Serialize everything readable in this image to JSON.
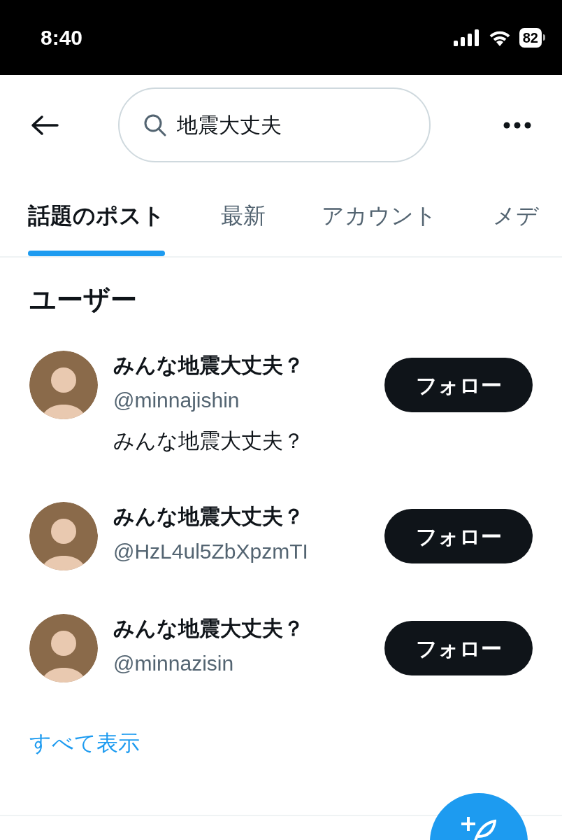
{
  "status_bar": {
    "time": "8:40",
    "battery": "82"
  },
  "search": {
    "value": "地震大丈夫"
  },
  "tabs": [
    {
      "label": "話題のポスト",
      "selected": true
    },
    {
      "label": "最新",
      "selected": false
    },
    {
      "label": "アカウント",
      "selected": false
    },
    {
      "label": "メデ",
      "selected": false
    }
  ],
  "users_section": {
    "heading": "ユーザー",
    "users": [
      {
        "name": "みんな地震大丈夫？",
        "handle": "@minnajishin",
        "bio": "みんな地震大丈夫？",
        "follow": "フォロー"
      },
      {
        "name": "みんな地震大丈夫？",
        "handle": "@HzL4ul5ZbXpzmTI",
        "follow": "フォロー"
      },
      {
        "name": "みんな地震大丈夫？",
        "handle": "@minnazisin",
        "follow": "フォロー"
      }
    ],
    "show_all": "すべて表示"
  }
}
